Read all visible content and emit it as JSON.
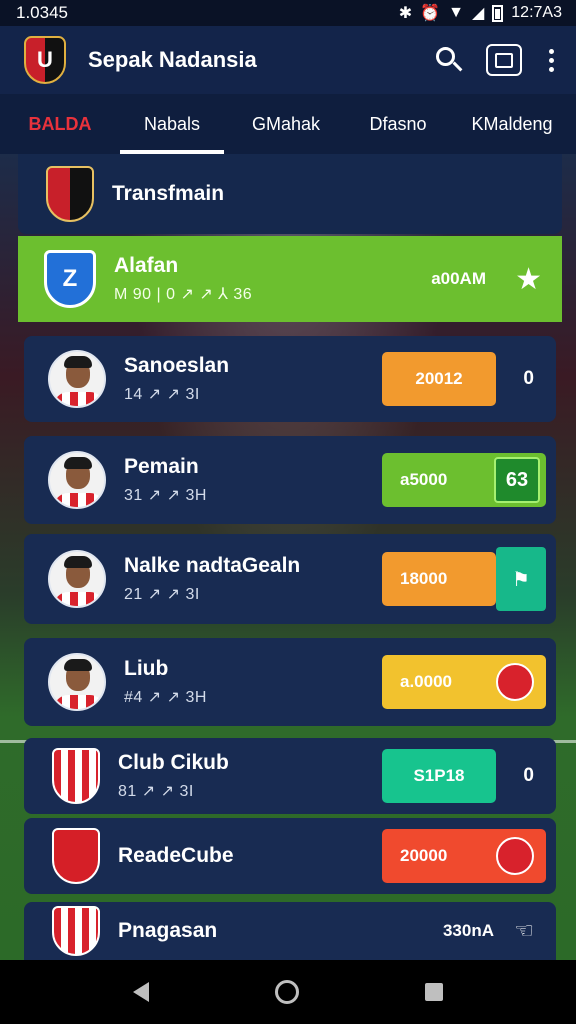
{
  "status_bar": {
    "time": "1.0345",
    "right_time": "12:7A3",
    "icons": [
      "signal-icon",
      "wifi-icon",
      "battery-icon"
    ]
  },
  "app_bar": {
    "title": "Sepak Nadansia",
    "logo": "club-logo"
  },
  "tabs": [
    {
      "label": "BALDA",
      "active": false,
      "color": "#e8323c"
    },
    {
      "label": "Nabals",
      "active": true
    },
    {
      "label": "GMahak",
      "active": false
    },
    {
      "label": "Dfasno",
      "active": false
    },
    {
      "label": "KMaldeng",
      "active": false
    }
  ],
  "rows": [
    {
      "type": "crest",
      "name": "Transfmain",
      "sub": ""
    },
    {
      "type": "highlight",
      "name": "Alafan",
      "sub": "M 90 | 0 ↗ ↗ ⅄ 36",
      "time": "a00AM",
      "star": "★",
      "color": "#6cbf2f"
    },
    {
      "type": "player",
      "name": "Sanoeslan",
      "sub": "14 ↗ ↗ 3I",
      "score": "20012",
      "score_color": "#f29a2e",
      "tail": "0"
    },
    {
      "type": "player",
      "name": "Pemain",
      "sub": "31 ↗ ↗ 3H",
      "score": "a5000",
      "score_color": "#6cbf2f",
      "tail": "63",
      "tail_color": "#1f8a2c"
    },
    {
      "type": "player",
      "name": "Nalke nadtaGealn",
      "sub": "21 ↗ ↗ 3I",
      "score": "18000",
      "score_color": "#f29a2e",
      "tail_color": "#17b88a",
      "tail_icon": "referee-icon"
    },
    {
      "type": "player",
      "name": "Liub",
      "sub": "#4 ↗ ↗ 3H",
      "score": "a.0000",
      "score_color": "#f2c22e",
      "tail_icon": "ball-icon"
    },
    {
      "type": "crest",
      "name": "Club Cikub",
      "sub": "81 ↗ ↗ 3I",
      "score": "S1P18",
      "score_color": "#17c48e",
      "tail": "0"
    },
    {
      "type": "crest",
      "name": "ReadeCube",
      "sub": "",
      "score": "20000",
      "score_color": "#f04a2e",
      "tail_icon": "ball-icon"
    },
    {
      "type": "crest",
      "name": "Pnagasan",
      "sub": "",
      "time": "330nA",
      "tail_icon": "hand-icon"
    }
  ]
}
